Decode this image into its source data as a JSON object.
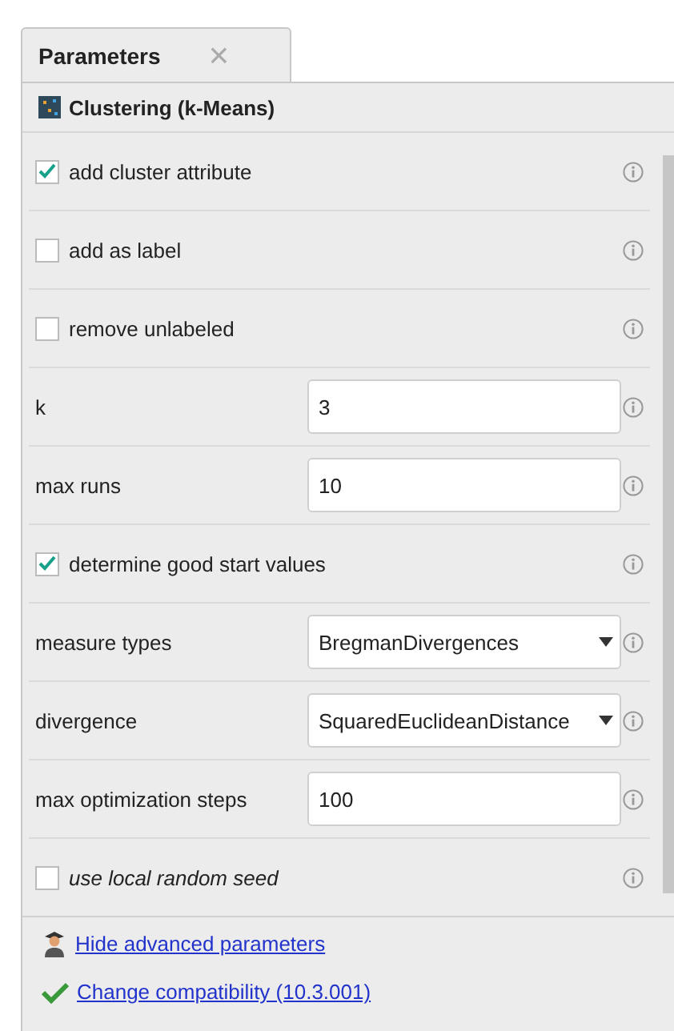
{
  "tab": {
    "label": "Parameters",
    "close": "×"
  },
  "operator": {
    "title": "Clustering (k-Means)"
  },
  "parameters": [
    {
      "kind": "checkbox",
      "label": "add cluster attribute",
      "checked": true,
      "expert": false
    },
    {
      "kind": "checkbox",
      "label": "add as label",
      "checked": false,
      "expert": false
    },
    {
      "kind": "checkbox",
      "label": "remove unlabeled",
      "checked": false,
      "expert": false
    },
    {
      "kind": "text",
      "label": "k",
      "value": "3",
      "expert": false
    },
    {
      "kind": "text",
      "label": "max runs",
      "value": "10",
      "expert": false
    },
    {
      "kind": "checkbox",
      "label": "determine good start values",
      "checked": true,
      "expert": false
    },
    {
      "kind": "select",
      "label": "measure types",
      "value": "BregmanDivergences",
      "expert": false
    },
    {
      "kind": "select",
      "label": "divergence",
      "value": "SquaredEuclideanDistance",
      "expert": false
    },
    {
      "kind": "text",
      "label": "max optimization steps",
      "value": "100",
      "expert": false
    },
    {
      "kind": "checkbox",
      "label": "use local random seed",
      "checked": false,
      "expert": true
    }
  ],
  "links": [
    {
      "kind": "advanced",
      "label": "Hide advanced parameters"
    },
    {
      "kind": "compat",
      "label": "Change compatibility (10.3.001)"
    }
  ]
}
